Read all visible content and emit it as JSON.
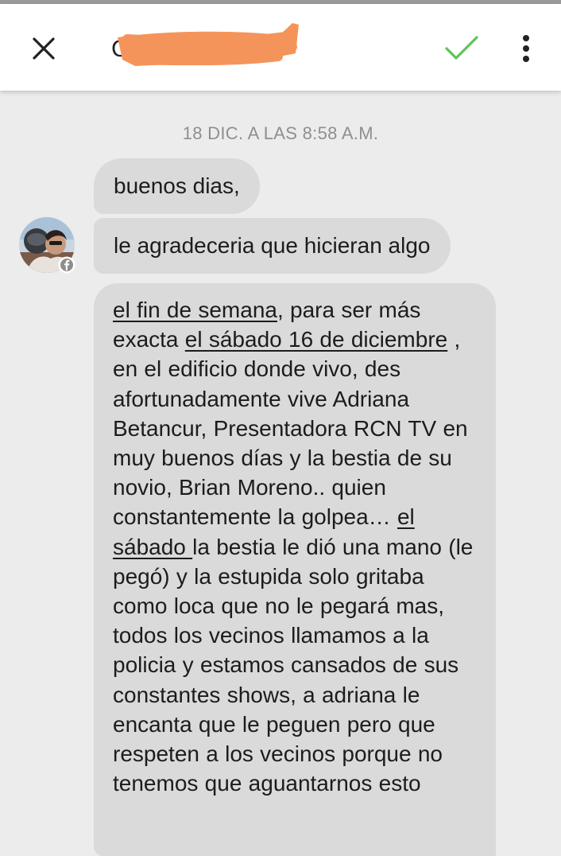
{
  "header": {
    "contact_name": "C",
    "close_icon": "close-icon",
    "check_icon": "check-icon",
    "more_icon": "more-vertical-icon",
    "redaction_color": "#f5945a",
    "check_color": "#5dc35b"
  },
  "conversation": {
    "timestamp": "18 DIC. A LAS 8:58 A.M.",
    "sender_source_icon": "facebook-icon",
    "messages": [
      {
        "text": "buenos dias,"
      },
      {
        "text": "le agradeceria que hicieran algo"
      },
      {
        "segments": [
          {
            "text": "el fin de semana",
            "underline": true
          },
          {
            "text": ", para ser más exacta ",
            "underline": false
          },
          {
            "text": "el sábado 16 de diciembre",
            "underline": true
          },
          {
            "text": " , en el edificio donde vivo, des afortunadamente vive Adriana Betancur, Presentadora RCN TV en muy buenos días y la bestia de su novio, Brian Moreno.. quien constantemente la golpea… ",
            "underline": false
          },
          {
            "text": "el sábado ",
            "underline": true
          },
          {
            "text": " la bestia le dió una mano (le pegó) y la estupida solo gritaba como loca que no le pegará mas, todos los vecinos llamamos a la policia y estamos cansados de sus constantes shows, a adriana le encanta que le peguen pero que respeten a los vecinos porque no tenemos que aguantarnos esto",
            "underline": false
          }
        ]
      }
    ]
  },
  "colors": {
    "background": "#ececec",
    "bubble": "#dadada",
    "timestamp": "#8f8f8f"
  }
}
